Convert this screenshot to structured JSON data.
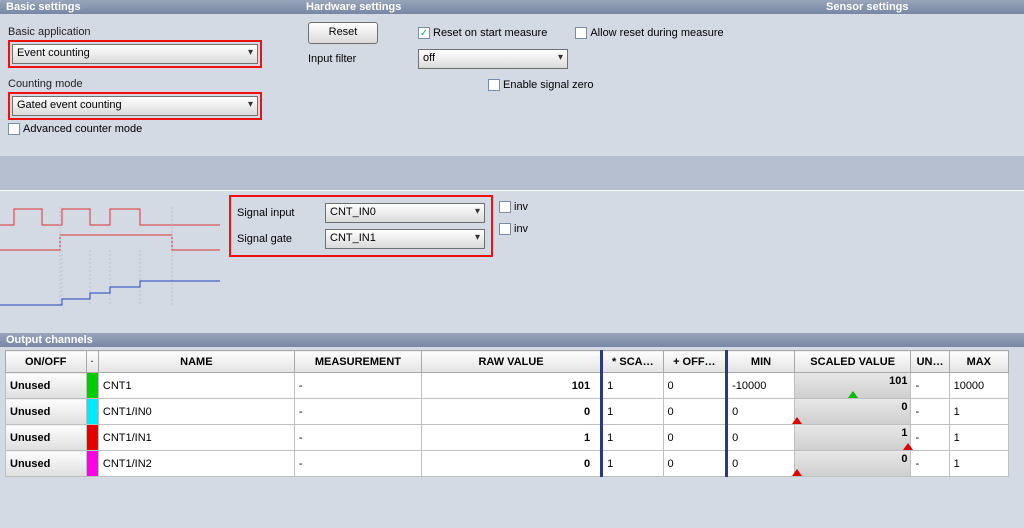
{
  "headers": {
    "basic": "Basic settings",
    "hardware": "Hardware settings",
    "sensor": "Sensor settings"
  },
  "basic": {
    "app_label": "Basic application",
    "app_value": "Event counting",
    "mode_label": "Counting mode",
    "mode_value": "Gated event counting",
    "adv_label": "Advanced counter mode"
  },
  "hw": {
    "reset_btn": "Reset",
    "reset_on_start": "Reset on start measure",
    "allow_reset": "Allow reset during measure",
    "filter_label": "Input filter",
    "filter_value": "off",
    "enable_zero": "Enable signal zero"
  },
  "signals": {
    "input_label": "Signal input",
    "input_value": "CNT_IN0",
    "gate_label": "Signal gate",
    "gate_value": "CNT_IN1",
    "inv": "inv"
  },
  "oc": {
    "title": "Output channels",
    "cols": {
      "onoff": "ON/OFF",
      "color": "·",
      "name": "NAME",
      "meas": "MEASUREMENT",
      "raw": "RAW VALUE",
      "sca": "* SCA…",
      "off": "+ OFF…",
      "min": "MIN",
      "scaled": "SCALED VALUE",
      "un": "UN…",
      "max": "MAX"
    },
    "rows": [
      {
        "onoff": "Unused",
        "color": "#00cc00",
        "name": "CNT1",
        "meas": "-",
        "raw": "101",
        "sca": "1",
        "off": "0",
        "min": "-10000",
        "scaled": "101",
        "tick": "green",
        "un": "-",
        "max": "10000"
      },
      {
        "onoff": "Unused",
        "color": "#00eaff",
        "name": "CNT1/IN0",
        "meas": "-",
        "raw": "0",
        "sca": "1",
        "off": "0",
        "min": "0",
        "scaled": "0",
        "tick": "red-l",
        "un": "-",
        "max": "1"
      },
      {
        "onoff": "Unused",
        "color": "#e60000",
        "name": "CNT1/IN1",
        "meas": "-",
        "raw": "1",
        "sca": "1",
        "off": "0",
        "min": "0",
        "scaled": "1",
        "tick": "red-r",
        "un": "-",
        "max": "1"
      },
      {
        "onoff": "Unused",
        "color": "#ff00e6",
        "name": "CNT1/IN2",
        "meas": "-",
        "raw": "0",
        "sca": "1",
        "off": "0",
        "min": "0",
        "scaled": "0",
        "tick": "red-l",
        "un": "-",
        "max": "1"
      }
    ]
  }
}
